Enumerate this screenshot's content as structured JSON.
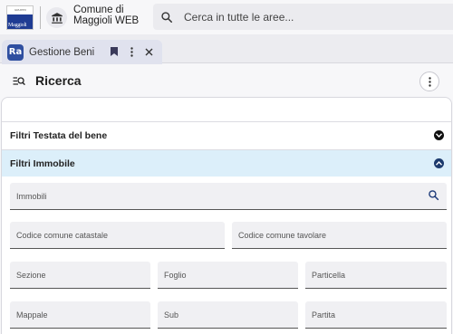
{
  "header": {
    "logo_text": "Maggioli",
    "logo_small": "GRUPPO",
    "app_name_line1": "Comune di",
    "app_name_line2": "Maggioli WEB",
    "search_placeholder": "Cerca in tutte le aree..."
  },
  "tab": {
    "icon_text": "Ra",
    "label": "Gestione Beni"
  },
  "page": {
    "title": "Ricerca"
  },
  "sections": {
    "testata": "Filtri Testata del bene",
    "immobile": "Filtri Immobile"
  },
  "fields": {
    "immobili": "Immobili",
    "codice_catastale": "Codice comune catastale",
    "codice_tavolare": "Codice comune tavolare",
    "sezione": "Sezione",
    "foglio": "Foglio",
    "particella": "Particella",
    "mappale": "Mappale",
    "sub": "Sub",
    "partita": "Partita"
  },
  "icons": {
    "home": "bank-icon",
    "search": "search-icon",
    "bookmark": "bookmark-icon",
    "more": "more-vert-icon",
    "close": "close-icon",
    "filter_search": "filter-search-icon",
    "collapse": "chevron-down-icon",
    "expand": "chevron-up-icon"
  },
  "colors": {
    "brand_blue": "#1f3c93",
    "section_active_bg": "#dceffa",
    "tab_icon_bg": "#2f4fa0"
  }
}
